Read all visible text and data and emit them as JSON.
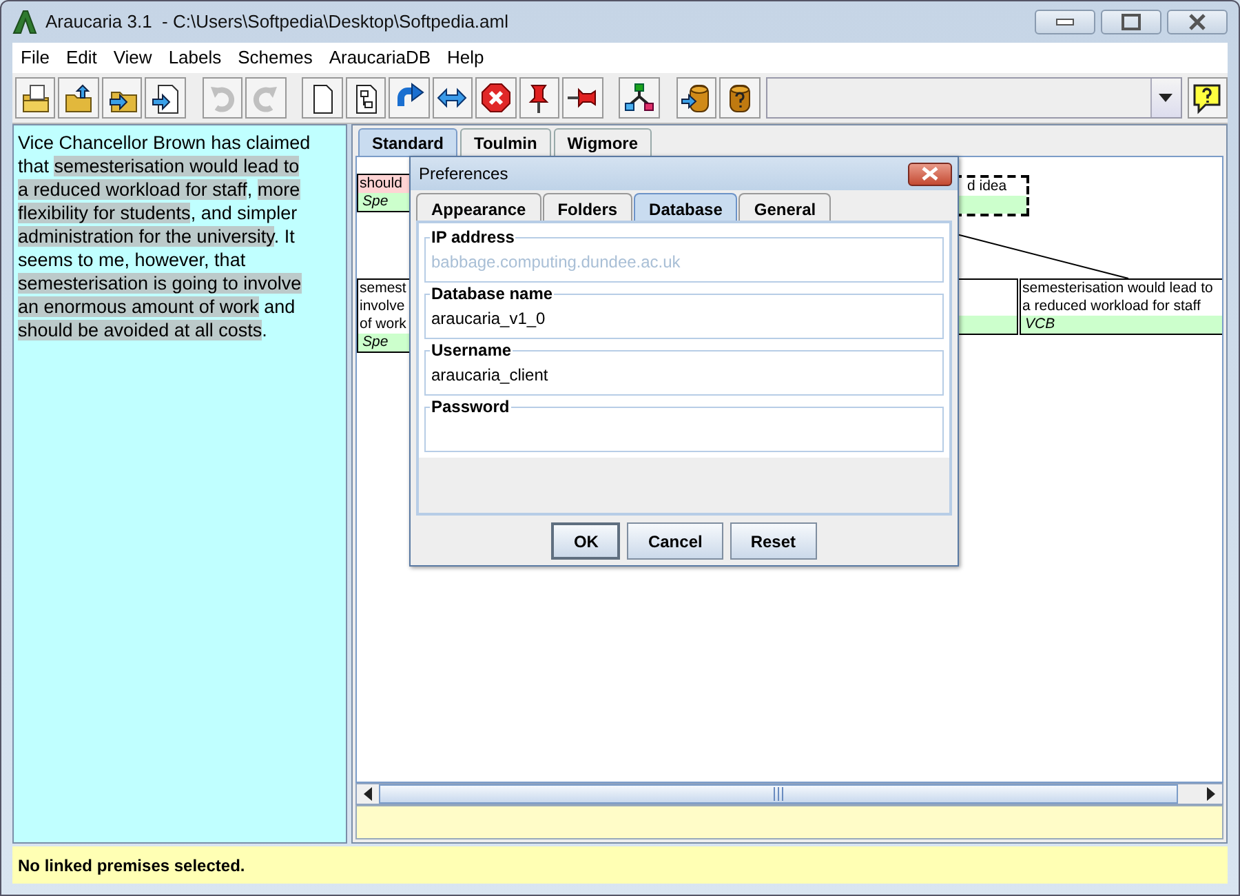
{
  "window": {
    "title": "Araucaria 3.1  - C:\\Users\\Softpedia\\Desktop\\Softpedia.aml"
  },
  "menu": [
    "File",
    "Edit",
    "View",
    "Labels",
    "Schemes",
    "AraucariaDB",
    "Help"
  ],
  "toolbar": [
    {
      "kind": "open",
      "disabled": false
    },
    {
      "kind": "save",
      "disabled": false
    },
    {
      "kind": "import",
      "disabled": false
    },
    {
      "kind": "export",
      "disabled": false
    },
    {
      "kind": "sep"
    },
    {
      "kind": "undo",
      "disabled": true
    },
    {
      "kind": "redo",
      "disabled": true
    },
    {
      "kind": "sep"
    },
    {
      "kind": "new",
      "disabled": false
    },
    {
      "kind": "diagram",
      "disabled": false
    },
    {
      "kind": "link",
      "disabled": false
    },
    {
      "kind": "swap",
      "disabled": false
    },
    {
      "kind": "delete",
      "disabled": false
    },
    {
      "kind": "pin",
      "disabled": false
    },
    {
      "kind": "unpin",
      "disabled": false
    },
    {
      "kind": "sep"
    },
    {
      "kind": "tree",
      "disabled": false
    },
    {
      "kind": "sep"
    },
    {
      "kind": "dbsend",
      "disabled": false
    },
    {
      "kind": "dbquery",
      "disabled": false
    }
  ],
  "text_panel": {
    "segments": [
      {
        "text": "Vice Chancellor Brown has claimed that ",
        "highlighted": false
      },
      {
        "text": "semesterisation would lead to a reduced workload for staff",
        "highlighted": true
      },
      {
        "text": ", ",
        "highlighted": false
      },
      {
        "text": "more flexibility for students",
        "highlighted": true
      },
      {
        "text": ", and simpler ",
        "highlighted": false
      },
      {
        "text": "administration for the university",
        "highlighted": true
      },
      {
        "text": ". It seems to me, however, that ",
        "highlighted": false
      },
      {
        "text": "semesterisation is going to involve an enormous amount of work",
        "highlighted": true
      },
      {
        "text": " and ",
        "highlighted": false
      },
      {
        "text": "should be avoided at all costs",
        "highlighted": true
      },
      {
        "text": ".",
        "highlighted": false
      }
    ]
  },
  "diagram_tabs": [
    {
      "label": "Standard",
      "selected": true
    },
    {
      "label": "Toulmin",
      "selected": false
    },
    {
      "label": "Wigmore",
      "selected": false
    }
  ],
  "nodes": [
    {
      "lines": [
        "should"
      ],
      "label": "Spe",
      "color": "#ffd4d4",
      "dashed": false
    },
    {
      "lines": [
        "d idea"
      ],
      "color": "#ffffff",
      "dashed": true
    },
    {
      "lines": [
        "semest",
        "involve",
        "of work"
      ],
      "label": "Spe",
      "color": "#ffffff",
      "dashed": false
    },
    {
      "color": "#ffffff",
      "dashed": false
    },
    {
      "lines": [
        "semesterisation would lead to",
        "a reduced workload for staff"
      ],
      "label": "VCB",
      "color": "#ffffff",
      "dashed": false
    }
  ],
  "status_bar": "No linked premises selected.",
  "dialog": {
    "title": "Preferences",
    "tabs": [
      {
        "label": "Appearance",
        "selected": false
      },
      {
        "label": "Folders",
        "selected": false
      },
      {
        "label": "Database",
        "selected": true
      },
      {
        "label": "General",
        "selected": false
      }
    ],
    "fields": [
      {
        "label": "IP address",
        "value": "babbage.computing.dundee.ac.uk",
        "disabled": true,
        "kind": "text"
      },
      {
        "label": "Database name",
        "value": "araucaria_v1_0",
        "disabled": false,
        "kind": "text"
      },
      {
        "label": "Username",
        "value": "araucaria_client",
        "disabled": false,
        "kind": "text"
      },
      {
        "label": "Password",
        "kind": "password"
      }
    ],
    "buttons": [
      {
        "label": "OK",
        "default": true
      },
      {
        "label": "Cancel",
        "default": false
      },
      {
        "label": "Reset",
        "default": false
      }
    ]
  }
}
